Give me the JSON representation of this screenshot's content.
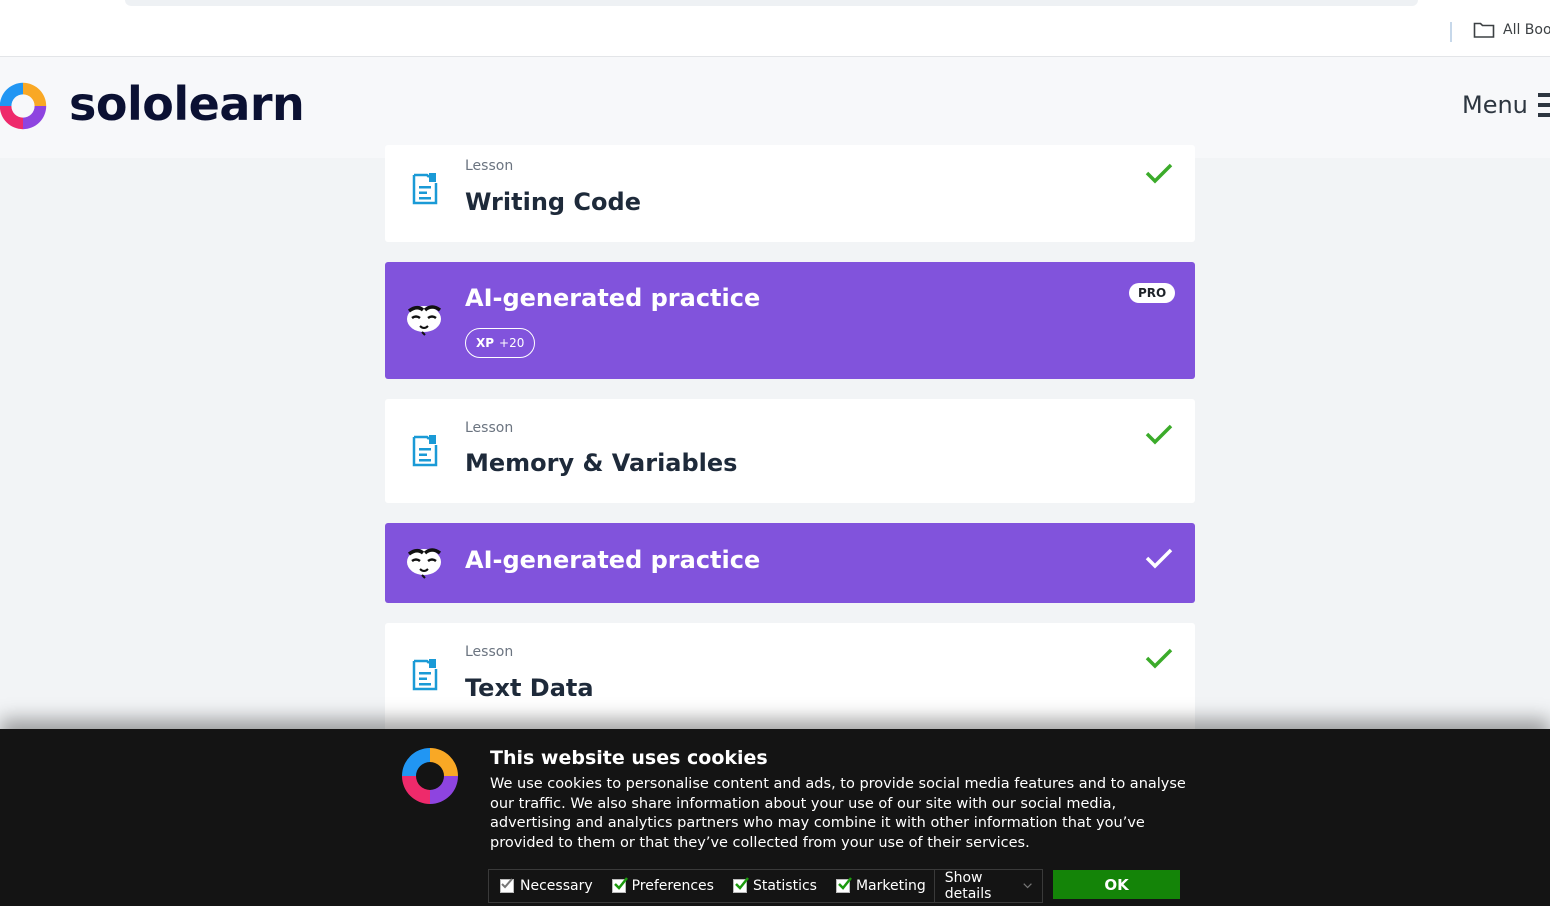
{
  "browser": {
    "bookmarks_label": "All Boo"
  },
  "header": {
    "brand": "sololearn",
    "menu_label": "Menu"
  },
  "cards": [
    {
      "type": "lesson",
      "kicker": "Lesson",
      "title": "Writing Code",
      "completed": true
    },
    {
      "type": "practice",
      "title": "AI-generated practice",
      "badge": "PRO",
      "xp_label": "XP",
      "xp_value": "+20",
      "completed": false
    },
    {
      "type": "lesson",
      "kicker": "Lesson",
      "title": "Memory & Variables",
      "completed": true
    },
    {
      "type": "practice",
      "title": "AI-generated practice",
      "completed": true
    },
    {
      "type": "lesson",
      "kicker": "Lesson",
      "title": "Text Data",
      "completed": true
    }
  ],
  "cookie_banner": {
    "title": "This website uses cookies",
    "text": "We use cookies to personalise content and ads, to provide social media features and to analyse our traffic. We also share information about your use of our site with our social media, advertising and analytics partners who may combine it with other information that you’ve provided to them or that they’ve collected from your use of their services.",
    "options": [
      {
        "label": "Necessary",
        "checked": true,
        "locked": true
      },
      {
        "label": "Preferences",
        "checked": true
      },
      {
        "label": "Statistics",
        "checked": true
      },
      {
        "label": "Marketing",
        "checked": true
      }
    ],
    "show_details": "Show details",
    "ok": "OK"
  },
  "colors": {
    "purple": "#8153dc",
    "check_green": "#3bab2a",
    "lesson_icon_blue": "#1a9ad6",
    "ok_green": "#148408"
  }
}
